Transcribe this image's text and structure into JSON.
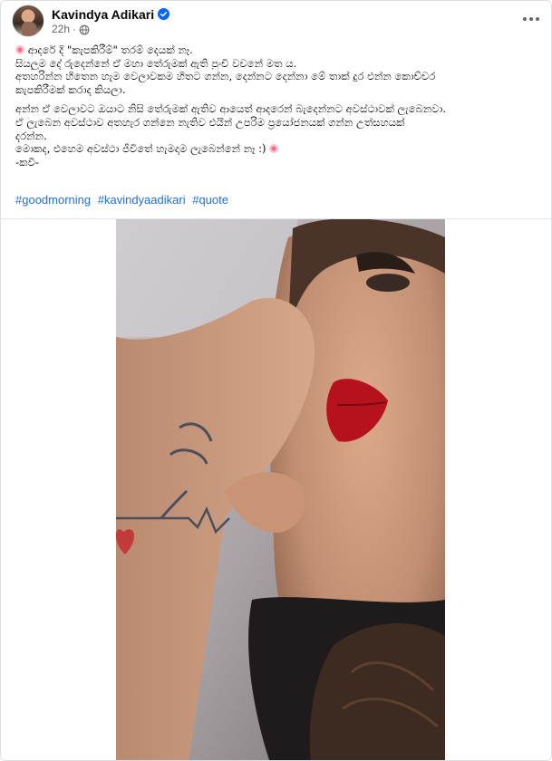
{
  "post": {
    "author": "Kavindya Adikari",
    "time": "22h",
    "separator": "·",
    "verified_icon": "verified-badge-icon",
    "privacy_icon": "globe-icon",
    "more_icon": "more-options-icon",
    "text_lines": [
      "ආදරේ දි \"කැපකිරීම්\" තරම් දෙයක් නෑ.",
      "සියලුම දේ රුදෙන්නේ ඒ මහා තේරුමක් ඇති පුංචි වචනේ මත ය.",
      "අතහරින්න හිතෙන හැම වෙලාවකම හිතට ගන්න, දෙන්නට දෙන්නා මේ තාක් දුර එන්න කොච්චර",
      "කැපකිරීමක් කරාද කියලා.",
      "",
      "අන්න ඒ වෙලාවට ඔයාට නිසි තේරුමක් ඇතිව ආයෙත් ආදරෙන් බැදෙන්නට අවස්ථාවක් ලැබෙනවා.",
      "ඒ ලැබෙන අවස්ථාව අතහැර ගන්නෙ නැතිව එයින් උපරිම ප්‍රයෝජනයක් ගන්න උත්සහයක්",
      "දරන්න.",
      "මොකද, එහෙම අවස්ථා ජීවිතේ හැමදාම ලැබෙන්නේ නෑ :)",
      "-කවී-"
    ],
    "hashtags": [
      "#goodmorning",
      "#kavindyaadikari",
      "#quote"
    ]
  },
  "colors": {
    "link": "#216fdb",
    "secondary_text": "#65676b",
    "verified": "#0866ff"
  }
}
